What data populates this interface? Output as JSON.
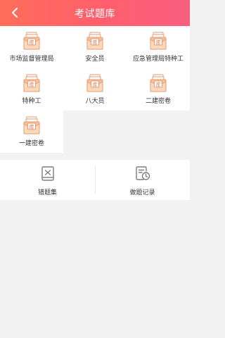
{
  "header": {
    "title": "考试题库",
    "back_icon": "back-arrow-icon"
  },
  "categories": [
    {
      "label": "市场监督管理局",
      "icon": "question-bank-icon",
      "badge": "库"
    },
    {
      "label": "安全员",
      "icon": "question-bank-icon",
      "badge": "库"
    },
    {
      "label": "应急管理局特种工",
      "icon": "question-bank-icon",
      "badge": "库"
    },
    {
      "label": "特种工",
      "icon": "question-bank-icon",
      "badge": "库"
    },
    {
      "label": "八大员",
      "icon": "question-bank-icon",
      "badge": "库"
    },
    {
      "label": "二建密卷",
      "icon": "question-bank-icon",
      "badge": "库"
    },
    {
      "label": "一建密卷",
      "icon": "question-bank-icon",
      "badge": "库"
    }
  ],
  "tools": [
    {
      "label": "错题集",
      "icon": "wrong-questions-icon"
    },
    {
      "label": "做题记录",
      "icon": "practice-history-icon"
    }
  ],
  "colors": {
    "header_gradient": [
      "#ff6d5a",
      "#f85e7e"
    ],
    "icon_accent": "#e79a72",
    "tool_icon": "#7d7d7d"
  }
}
